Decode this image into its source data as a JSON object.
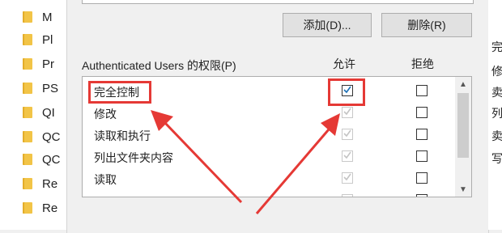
{
  "explorer": {
    "folders": [
      "M",
      "Pl",
      "Pr",
      "PS",
      "QI",
      "QC",
      "QC",
      "Re",
      "Re"
    ]
  },
  "dialog": {
    "add_button": "添加(D)...",
    "remove_button": "删除(R)",
    "permissions_label": "Authenticated Users 的权限(P)",
    "col_allow": "允许",
    "col_deny": "拒绝",
    "permissions": [
      {
        "name": "完全控制",
        "allow": true,
        "allow_enabled": true,
        "deny": false
      },
      {
        "name": "修改",
        "allow": true,
        "allow_enabled": false,
        "deny": false
      },
      {
        "name": "读取和执行",
        "allow": true,
        "allow_enabled": false,
        "deny": false
      },
      {
        "name": "列出文件夹内容",
        "allow": true,
        "allow_enabled": false,
        "deny": false
      },
      {
        "name": "读取",
        "allow": true,
        "allow_enabled": false,
        "deny": false
      }
    ]
  },
  "right_panel": {
    "chars": [
      "完",
      "修",
      "卖",
      "列",
      "卖",
      "写"
    ]
  },
  "colors": {
    "annotation": "#e53935",
    "checkbox_border": "#333333"
  }
}
